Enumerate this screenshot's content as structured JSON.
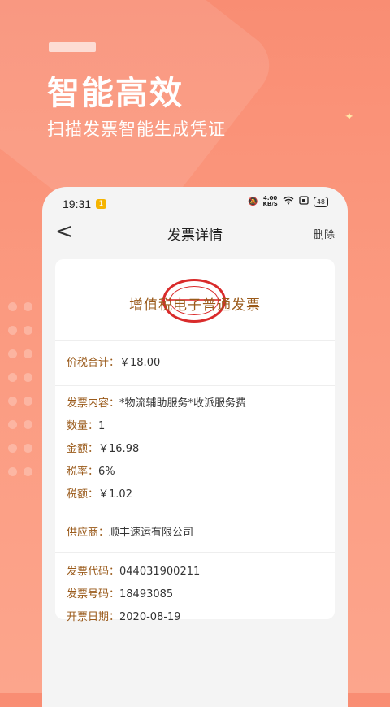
{
  "promo": {
    "headline": "智能高效",
    "subline": "扫描发票智能生成凭证"
  },
  "status_bar": {
    "time": "19:31",
    "notification_badge": "1",
    "network_speed_value": "4.00",
    "network_speed_unit": "KB/S",
    "battery": "48"
  },
  "nav": {
    "back_label": "<",
    "title": "发票详情",
    "delete_label": "删除"
  },
  "invoice": {
    "title": "增值税电子普通发票",
    "total_label": "价税合计：",
    "total_value": "￥18.00",
    "content_label": "发票内容：",
    "content_value": "*物流辅助服务*收派服务费",
    "quantity_label": "数量：",
    "quantity_value": "1",
    "amount_label": "金额：",
    "amount_value": "￥16.98",
    "tax_rate_label": "税率：",
    "tax_rate_value": "6%",
    "tax_amount_label": "税额：",
    "tax_amount_value": "￥1.02",
    "supplier_label": "供应商：",
    "supplier_value": "顺丰速运有限公司",
    "code_label": "发票代码：",
    "code_value": "044031900211",
    "number_label": "发票号码：",
    "number_value": "18493085",
    "date_label": "开票日期：",
    "date_value": "2020-08-19"
  },
  "colors": {
    "background": "#f98d73",
    "label_brown": "#9a5a1a",
    "stamp_red": "#d92b2b"
  }
}
